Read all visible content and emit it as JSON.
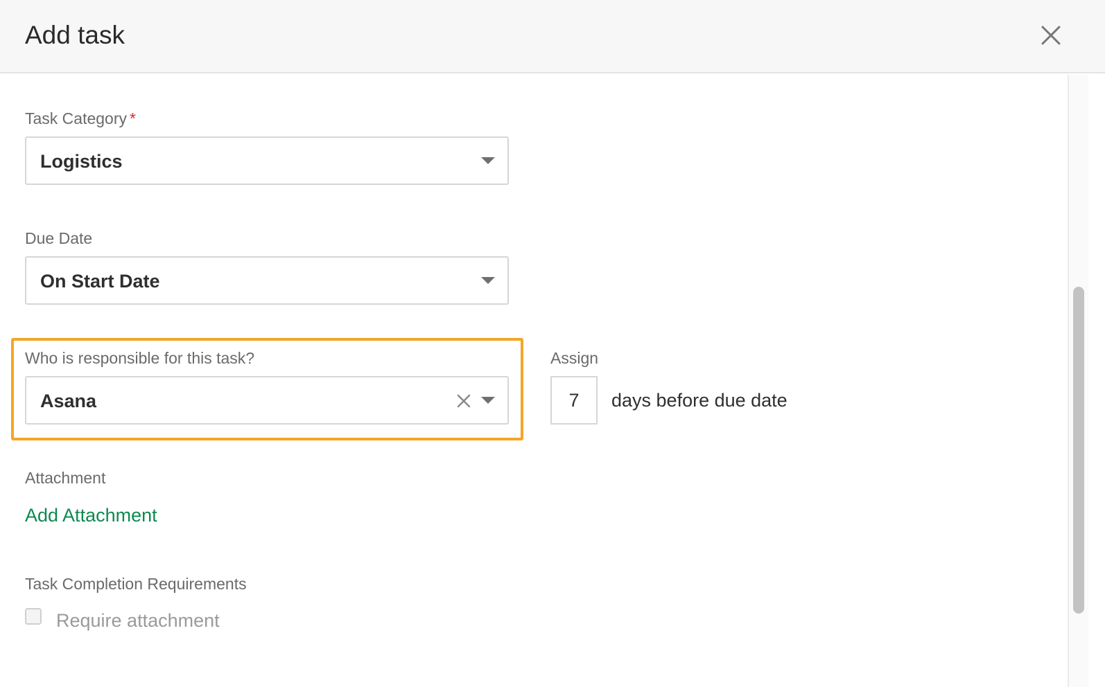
{
  "modal": {
    "title": "Add task",
    "close_icon": "close-icon"
  },
  "task_category": {
    "label": "Task Category",
    "required_marker": "*",
    "value": "Logistics"
  },
  "due_date": {
    "label": "Due Date",
    "value": "On Start Date"
  },
  "responsible": {
    "label": "Who is responsible for this task?",
    "value": "Asana",
    "clear_icon": "clear-x-icon",
    "highlight_color": "#f5a524"
  },
  "assign": {
    "label": "Assign",
    "days_value": "7",
    "suffix": "days before due date"
  },
  "attachment": {
    "label": "Attachment",
    "add_link": "Add Attachment",
    "link_color": "#0d8a50"
  },
  "completion": {
    "label": "Task Completion Requirements",
    "checkbox_label": "Require attachment",
    "checked": false
  }
}
